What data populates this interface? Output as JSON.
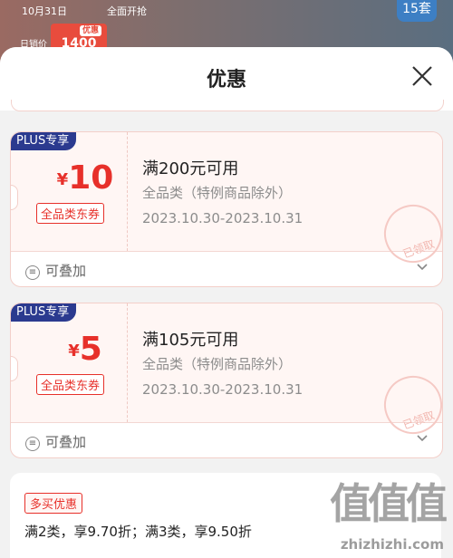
{
  "background": {
    "date_text": "10月31日",
    "promo_text": "全面开抢",
    "price_tag": "优惠",
    "price": "1400",
    "daily_price": "日销价",
    "count": "15套"
  },
  "sheet": {
    "title": "优惠",
    "close_icon": "close-icon"
  },
  "coupons": [
    {
      "badge": "PLUS专享",
      "currency": "¥",
      "amount": "10",
      "type": "全品类东券",
      "condition": "满200元可用",
      "scope": "全品类（特例商品除外）",
      "validity": "2023.10.30-2023.10.31",
      "stamp": "已领取",
      "stackable": "可叠加"
    },
    {
      "badge": "PLUS专享",
      "currency": "¥",
      "amount": "5",
      "type": "全品类东券",
      "condition": "满105元可用",
      "scope": "全品类（特例商品除外）",
      "validity": "2023.10.30-2023.10.31",
      "stamp": "已领取",
      "stackable": "可叠加"
    }
  ],
  "multi_buy": {
    "badge": "多买优惠",
    "description": "满2类，享9.70折；满3类，享9.50折"
  },
  "watermark": {
    "logo": "值值值",
    "url": "zhizhizhi.com"
  },
  "colors": {
    "accent_red": "#e7302a",
    "plus_blue": "#2b3a8f"
  }
}
